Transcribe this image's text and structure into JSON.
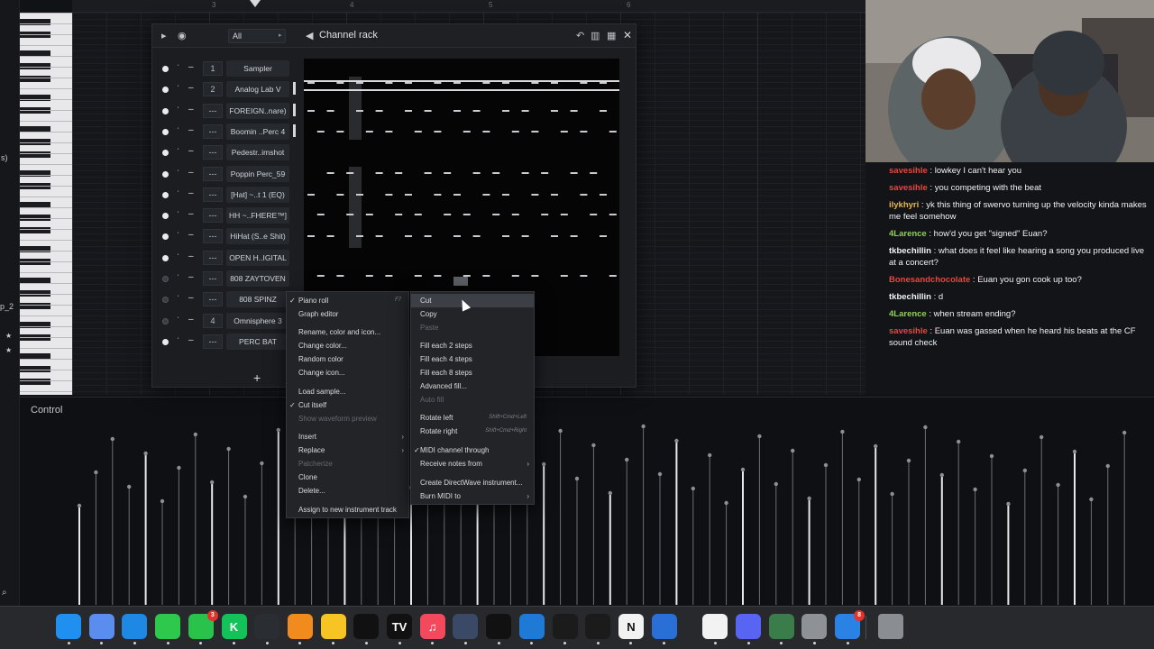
{
  "ruler": {
    "marks": [
      "3",
      "4",
      "5",
      "6"
    ]
  },
  "left_sidebar": {
    "fragment_1": "s)",
    "fragment_2": "p_2"
  },
  "channel_rack": {
    "title": "Channel rack",
    "filter": "All",
    "channels": [
      {
        "number": "1",
        "name": "Sampler",
        "active": true
      },
      {
        "number": "2",
        "name": "Analog Lab V",
        "active": true
      },
      {
        "number": "---",
        "name": "FOREIGN..nare)",
        "active": true
      },
      {
        "number": "---",
        "name": "Boomin ..Perc 4",
        "active": true
      },
      {
        "number": "---",
        "name": "Pedestr..imshot",
        "active": true
      },
      {
        "number": "---",
        "name": "Poppin Perc_59",
        "active": true
      },
      {
        "number": "---",
        "name": "[Hat] ~..t 1 (EQ)",
        "active": true
      },
      {
        "number": "---",
        "name": "HH ~..FHERE™]",
        "active": true
      },
      {
        "number": "---",
        "name": "HiHat (S..e Shit)",
        "active": true
      },
      {
        "number": "---",
        "name": "OPEN H..IGITAL",
        "active": true
      },
      {
        "number": "---",
        "name": "808 ZAYTOVEN",
        "active": false
      },
      {
        "number": "---",
        "name": "808 SPINZ",
        "active": false
      },
      {
        "number": "4",
        "name": "Omnisphere 3",
        "active": false
      },
      {
        "number": "---",
        "name": "PERC BAT",
        "active": true
      }
    ],
    "add_label": "+"
  },
  "context_menu": {
    "items": [
      {
        "label": "Piano roll",
        "checked": true,
        "shortcut": "F7",
        "arrow": false,
        "disabled": false
      },
      {
        "label": "Graph editor",
        "checked": false,
        "shortcut": "",
        "arrow": false,
        "disabled": false
      },
      {
        "label": "Rename, color and icon...",
        "checked": false,
        "shortcut": "",
        "arrow": false,
        "disabled": false
      },
      {
        "label": "Change color...",
        "checked": false,
        "shortcut": "",
        "arrow": false,
        "disabled": false
      },
      {
        "label": "Random color",
        "checked": false,
        "shortcut": "",
        "arrow": false,
        "disabled": false
      },
      {
        "label": "Change icon...",
        "checked": false,
        "shortcut": "",
        "arrow": false,
        "disabled": false
      },
      {
        "label": "Load sample...",
        "checked": false,
        "shortcut": "",
        "arrow": false,
        "disabled": false
      },
      {
        "label": "Cut itself",
        "checked": true,
        "shortcut": "",
        "arrow": false,
        "disabled": false
      },
      {
        "label": "Show waveform preview",
        "checked": false,
        "shortcut": "",
        "arrow": false,
        "disabled": true
      },
      {
        "label": "Insert",
        "checked": false,
        "shortcut": "",
        "arrow": true,
        "disabled": false
      },
      {
        "label": "Replace",
        "checked": false,
        "shortcut": "",
        "arrow": true,
        "disabled": false
      },
      {
        "label": "Patcherize",
        "checked": false,
        "shortcut": "",
        "arrow": false,
        "disabled": true
      },
      {
        "label": "Clone",
        "checked": false,
        "shortcut": "",
        "arrow": false,
        "disabled": false
      },
      {
        "label": "Delete...",
        "checked": false,
        "shortcut": "",
        "arrow": false,
        "disabled": false
      },
      {
        "label": "Assign to new instrument track",
        "checked": false,
        "shortcut": "",
        "arrow": false,
        "disabled": false
      }
    ]
  },
  "submenu": {
    "items": [
      {
        "label": "Cut",
        "highlighted": true,
        "disabled": false,
        "shortcut": "",
        "arrow": false,
        "checked": false
      },
      {
        "label": "Copy",
        "highlighted": false,
        "disabled": false,
        "shortcut": "",
        "arrow": false,
        "checked": false
      },
      {
        "label": "Paste",
        "highlighted": false,
        "disabled": true,
        "shortcut": "",
        "arrow": false,
        "checked": false
      },
      {
        "label": "Fill each 2 steps",
        "highlighted": false,
        "disabled": false,
        "shortcut": "",
        "arrow": false,
        "checked": false
      },
      {
        "label": "Fill each 4 steps",
        "highlighted": false,
        "disabled": false,
        "shortcut": "",
        "arrow": false,
        "checked": false
      },
      {
        "label": "Fill each 8 steps",
        "highlighted": false,
        "disabled": false,
        "shortcut": "",
        "arrow": false,
        "checked": false
      },
      {
        "label": "Advanced fill...",
        "highlighted": false,
        "disabled": false,
        "shortcut": "",
        "arrow": false,
        "checked": false
      },
      {
        "label": "Auto fill",
        "highlighted": false,
        "disabled": true,
        "shortcut": "",
        "arrow": false,
        "checked": false
      },
      {
        "label": "Rotate left",
        "highlighted": false,
        "disabled": false,
        "shortcut": "Shift+Cmd+Left",
        "arrow": false,
        "checked": false
      },
      {
        "label": "Rotate right",
        "highlighted": false,
        "disabled": false,
        "shortcut": "Shift+Cmd+Right",
        "arrow": false,
        "checked": false
      },
      {
        "label": "MIDI channel through",
        "highlighted": false,
        "disabled": false,
        "shortcut": "",
        "arrow": false,
        "checked": true
      },
      {
        "label": "Receive notes from",
        "highlighted": false,
        "disabled": false,
        "shortcut": "",
        "arrow": true,
        "checked": false
      },
      {
        "label": "Create DirectWave instrument...",
        "highlighted": false,
        "disabled": false,
        "shortcut": "",
        "arrow": false,
        "checked": false
      },
      {
        "label": "Burn MIDI to",
        "highlighted": false,
        "disabled": false,
        "shortcut": "",
        "arrow": true,
        "checked": false
      }
    ]
  },
  "control_lane": {
    "label": "Control"
  },
  "chat": [
    {
      "user": "savesihle",
      "color": "#e8473c",
      "text": "lowkey I can't hear you"
    },
    {
      "user": "savesihle",
      "color": "#e8473c",
      "text": "you competing with the beat"
    },
    {
      "user": "ilykhyri",
      "color": "#e6b84a",
      "text": "yk this thing of swervo turning up the velocity kinda makes me feel somehow"
    },
    {
      "user": "4Larence",
      "color": "#8fd14f",
      "text": "how'd you get \"signed\" Euan?"
    },
    {
      "user": "tkbechillin",
      "color": "#f1f2f4",
      "text": "what does it feel like hearing a song you produced live at a concert?"
    },
    {
      "user": "Bonesandchocolate",
      "color": "#e8473c",
      "text": "Euan you gon cook up too?"
    },
    {
      "user": "tkbechillin",
      "color": "#f1f2f4",
      "text": "d"
    },
    {
      "user": "4Larence",
      "color": "#8fd14f",
      "text": "when stream ending?"
    },
    {
      "user": "savesihle",
      "color": "#e8473c",
      "text": "Euan was gassed when he heard his beats at the CF sound check"
    }
  ],
  "dock": {
    "items": [
      {
        "name": "finder-icon",
        "glyph": "",
        "color": "#1f8ff0"
      },
      {
        "name": "files-icon",
        "glyph": "",
        "color": "#5a8dee"
      },
      {
        "name": "safari-icon",
        "glyph": "",
        "color": "#1e88e5"
      },
      {
        "name": "messages-icon",
        "glyph": "",
        "color": "#2ec84d"
      },
      {
        "name": "facetime-icon",
        "glyph": "",
        "color": "#29c24a",
        "badge": "3"
      },
      {
        "name": "kick-icon",
        "glyph": "K",
        "color": "#14c25a"
      },
      {
        "name": "activity-monitor-icon",
        "glyph": "",
        "color": "#2a2d31"
      },
      {
        "name": "fl-studio-icon",
        "glyph": "",
        "color": "#f28b1e"
      },
      {
        "name": "notes-icon",
        "glyph": "",
        "color": "#f6c523"
      },
      {
        "name": "capcut-icon",
        "glyph": "",
        "color": "#111111"
      },
      {
        "name": "tradingview-icon",
        "glyph": "TV",
        "color": "#111111"
      },
      {
        "name": "music-icon",
        "glyph": "♫",
        "color": "#f24a5c"
      },
      {
        "name": "davinci-resolve-icon",
        "glyph": "",
        "color": "#3a4a66"
      },
      {
        "name": "github-icon",
        "glyph": "",
        "color": "#111111"
      },
      {
        "name": "vscode-icon",
        "glyph": "",
        "color": "#1f7ad6"
      },
      {
        "name": "chatgpt-icon",
        "glyph": "",
        "color": "#1b1b1b"
      },
      {
        "name": "capcut-alt-icon",
        "glyph": "",
        "color": "#1b1b1b"
      },
      {
        "name": "notion-icon",
        "glyph": "N",
        "color": "#f2f2f2"
      },
      {
        "name": "cube-app-icon",
        "glyph": "",
        "color": "#2a6fd6"
      },
      {
        "name": "chrome-icon",
        "glyph": "",
        "color": "#f2f2f2"
      },
      {
        "name": "discord-icon",
        "glyph": "",
        "color": "#5865f2"
      },
      {
        "name": "photo-booth-icon",
        "glyph": "",
        "color": "#3a7d4a"
      },
      {
        "name": "system-settings-icon",
        "glyph": "",
        "color": "#8e9296"
      },
      {
        "name": "safari-alt-icon",
        "glyph": "",
        "color": "#2a82e4",
        "badge": "8"
      }
    ],
    "trash": "trash-icon"
  }
}
